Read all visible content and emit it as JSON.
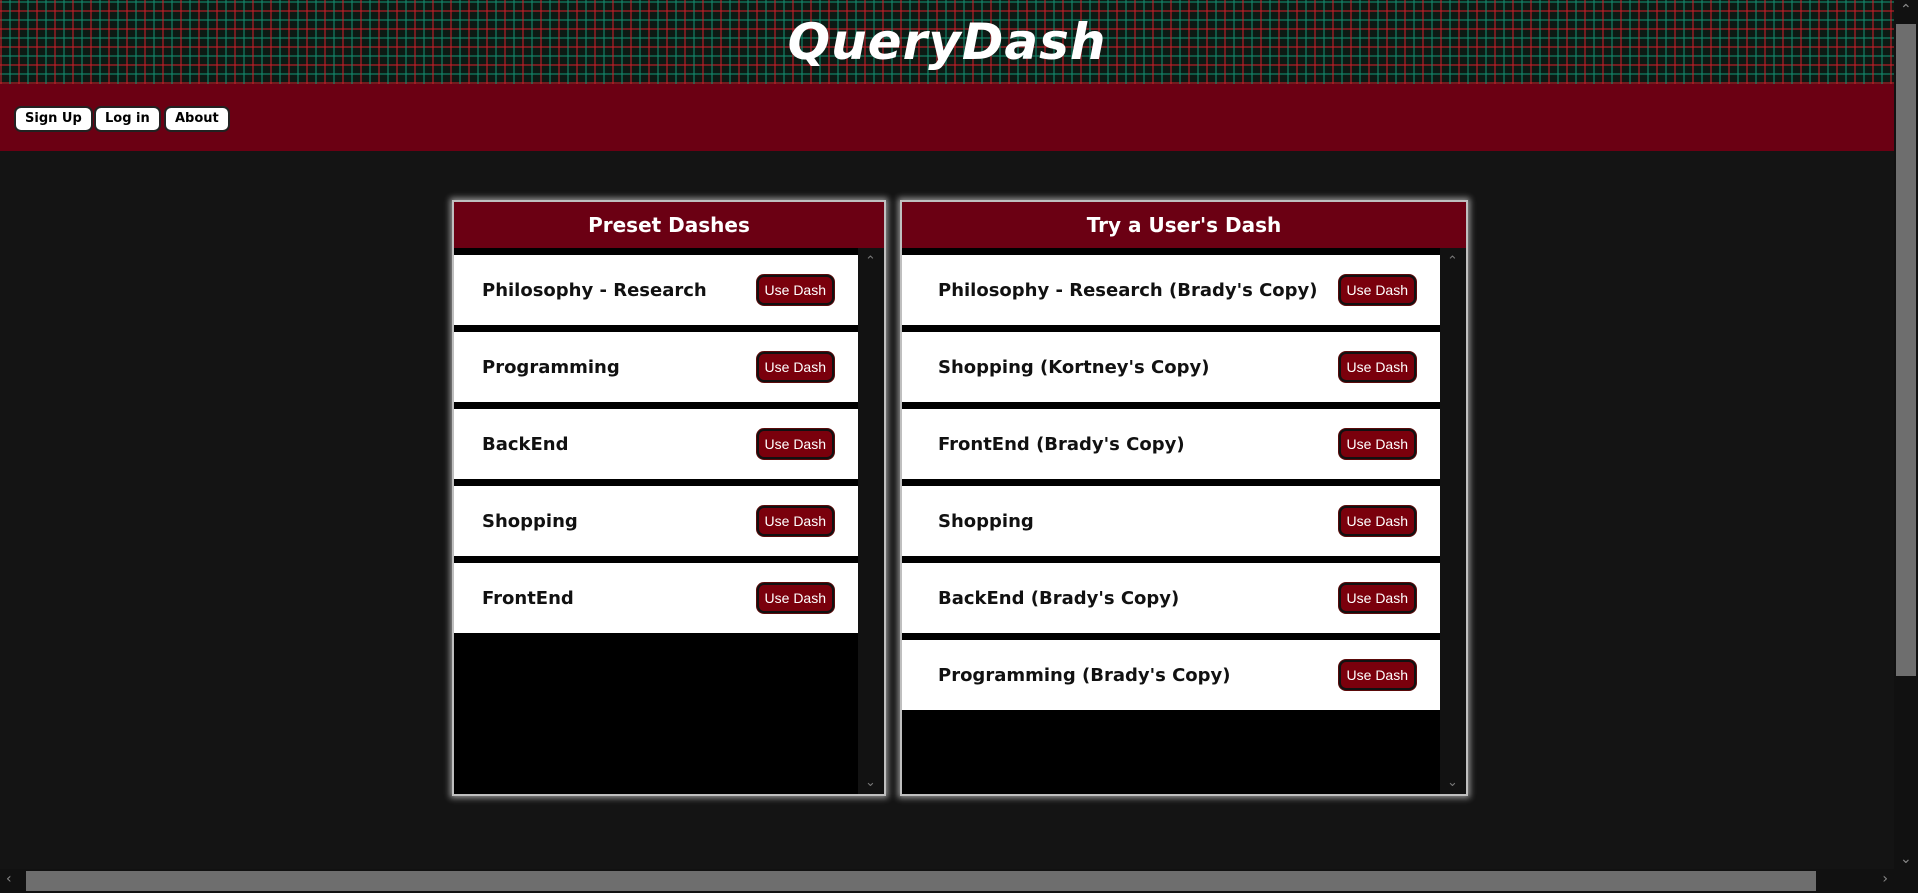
{
  "header": {
    "title": "QueryDash"
  },
  "nav": {
    "signup": "Sign Up",
    "login": "Log in",
    "about": "About"
  },
  "preset": {
    "title": "Preset Dashes",
    "items": [
      {
        "label": "Philosophy - Research",
        "button": "Use Dash"
      },
      {
        "label": "Programming",
        "button": "Use Dash"
      },
      {
        "label": "BackEnd",
        "button": "Use Dash"
      },
      {
        "label": "Shopping",
        "button": "Use Dash"
      },
      {
        "label": "FrontEnd",
        "button": "Use Dash"
      }
    ]
  },
  "user": {
    "title": "Try a User's Dash",
    "items": [
      {
        "label": "Philosophy - Research (Brady's Copy)",
        "button": "Use Dash"
      },
      {
        "label": "Shopping (Kortney's Copy)",
        "button": "Use Dash"
      },
      {
        "label": "FrontEnd (Brady's Copy)",
        "button": "Use Dash"
      },
      {
        "label": "Shopping",
        "button": "Use Dash"
      },
      {
        "label": "BackEnd (Brady's Copy)",
        "button": "Use Dash"
      },
      {
        "label": "Programming (Brady's Copy)",
        "button": "Use Dash"
      }
    ]
  },
  "icons": {
    "scroll_up": "chevron-up-icon",
    "scroll_down": "chevron-down-icon",
    "scroll_left": "chevron-left-icon",
    "scroll_right": "chevron-right-icon"
  },
  "colors": {
    "brand": "#6b0013",
    "button": "#7a000c",
    "background": "#141414"
  }
}
